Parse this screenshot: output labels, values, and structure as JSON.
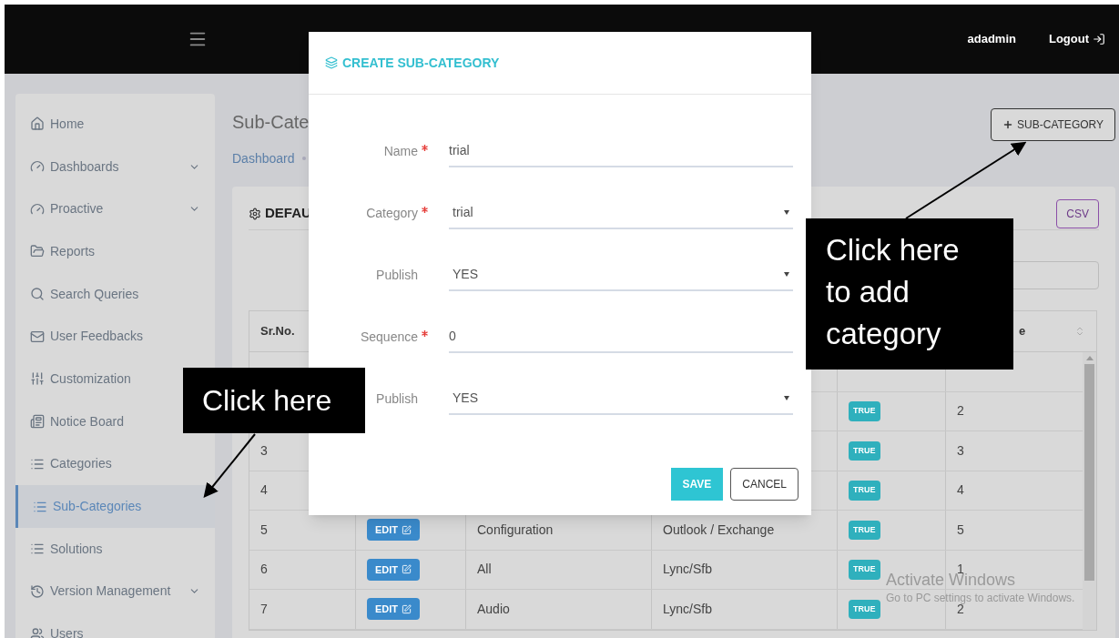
{
  "header": {
    "user": "adadmin",
    "logout": "Logout"
  },
  "sidebar": {
    "items": [
      {
        "label": "Home",
        "expandable": false,
        "selected": false
      },
      {
        "label": "Dashboards",
        "expandable": true,
        "selected": false
      },
      {
        "label": "Proactive",
        "expandable": true,
        "selected": false
      },
      {
        "label": "Reports",
        "expandable": false,
        "selected": false
      },
      {
        "label": "Search Queries",
        "expandable": false,
        "selected": false
      },
      {
        "label": "User Feedbacks",
        "expandable": false,
        "selected": false
      },
      {
        "label": "Customization",
        "expandable": false,
        "selected": false
      },
      {
        "label": "Notice Board",
        "expandable": false,
        "selected": false
      },
      {
        "label": "Categories",
        "expandable": false,
        "selected": false
      },
      {
        "label": "Sub-Categories",
        "expandable": false,
        "selected": true
      },
      {
        "label": "Solutions",
        "expandable": false,
        "selected": false
      },
      {
        "label": "Version Management",
        "expandable": true,
        "selected": false
      },
      {
        "label": "Users",
        "expandable": false,
        "selected": false
      }
    ]
  },
  "page": {
    "title": "Sub-Cate",
    "breadcrumb": "Dashboard",
    "add_button": "SUB-CATEGORY"
  },
  "card": {
    "title": "DEFAU",
    "csv_button": "CSV"
  },
  "table": {
    "header": {
      "sr_no": "Sr.No.",
      "column_6": "e"
    },
    "rows": [
      {},
      {
        "status": "TRUE",
        "column_6": "2"
      },
      {
        "sr_no": "3",
        "status": "TRUE",
        "column_6": "3"
      },
      {
        "sr_no": "4",
        "status": "TRUE",
        "column_6": "4"
      },
      {
        "sr_no": "5",
        "edit": "EDIT",
        "column_3": "Configuration",
        "column_4": "Outlook / Exchange",
        "status": "TRUE",
        "column_6": "5"
      },
      {
        "sr_no": "6",
        "edit": "EDIT",
        "column_3": "All",
        "column_4": "Lync/Sfb",
        "status": "TRUE",
        "column_6": "1"
      },
      {
        "sr_no": "7",
        "edit": "EDIT",
        "column_3": "Audio",
        "column_4": "Lync/Sfb",
        "status": "TRUE",
        "column_6": "2"
      }
    ]
  },
  "modal": {
    "title": "CREATE SUB-CATEGORY",
    "fields": [
      {
        "label": "Name",
        "required": true,
        "kind": "text",
        "value": "trial"
      },
      {
        "label": "Category",
        "required": true,
        "kind": "select",
        "value": "trial"
      },
      {
        "label": "Publish",
        "required": false,
        "kind": "select",
        "value": "YES"
      },
      {
        "label": "Sequence",
        "required": true,
        "kind": "text",
        "value": "0"
      },
      {
        "label": "Publish",
        "required": false,
        "kind": "select",
        "value": "YES"
      }
    ],
    "save_button": "SAVE",
    "cancel_button": "CANCEL"
  },
  "callouts": [
    {
      "text": "Click here"
    },
    {
      "text": "Click here to add category"
    }
  ],
  "os_notice": {
    "title": "Activate Windows",
    "text": "Go to PC settings to activate Windows."
  }
}
